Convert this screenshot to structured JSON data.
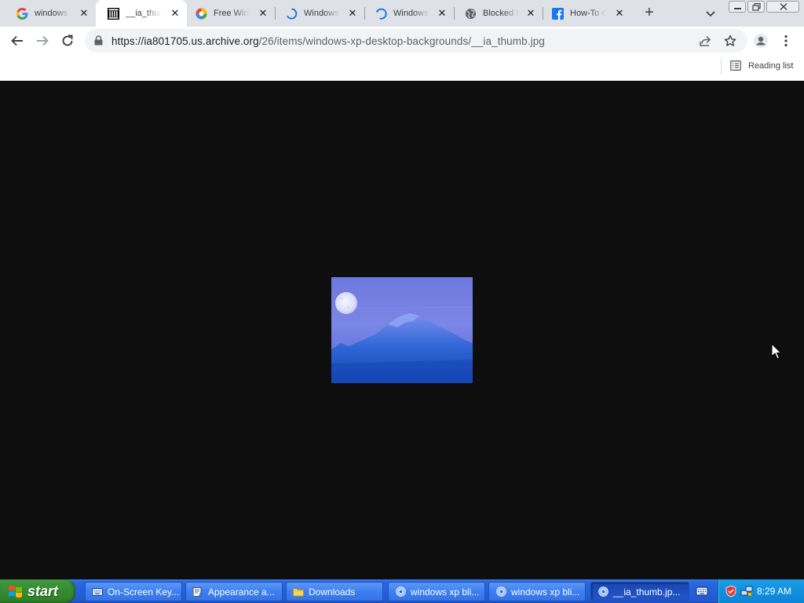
{
  "browser": {
    "tabs": [
      {
        "title": "windows xp",
        "icon": "google-g-icon"
      },
      {
        "title": "__ia_thumb",
        "icon": "archive-org-icon",
        "active": true
      },
      {
        "title": "Free Windows",
        "icon": "colorwheel-icon"
      },
      {
        "title": "Windows",
        "icon": "loading-spinner-icon"
      },
      {
        "title": "Windows",
        "icon": "loading-spinner-icon"
      },
      {
        "title": "Blocked by",
        "icon": "globe-icon"
      },
      {
        "title": "How-To Geek",
        "icon": "facebook-icon"
      }
    ],
    "url_host": "https://ia801705.us.archive.org",
    "url_path": "/26/items/windows-xp-desktop-backgrounds/__ia_thumb.jpg",
    "reading_list_label": "Reading list"
  },
  "page": {
    "background_color": "#0e0e0e",
    "image": {
      "description": "moon-over-mountain",
      "tint": "#5a6fe0"
    }
  },
  "taskbar": {
    "start_label": "start",
    "buttons": [
      {
        "label": "On-Screen Key...",
        "icon": "keyboard-icon"
      },
      {
        "label": "Appearance a...",
        "icon": "display-properties-icon"
      },
      {
        "label": "Downloads",
        "icon": "folder-icon"
      },
      {
        "label": "windows xp bli...",
        "icon": "chrome-icon"
      },
      {
        "label": "windows xp bli...",
        "icon": "chrome-icon"
      },
      {
        "label": "__ia_thumb.jp...",
        "icon": "chrome-icon",
        "active": true
      }
    ],
    "clock": "8:29 AM"
  }
}
